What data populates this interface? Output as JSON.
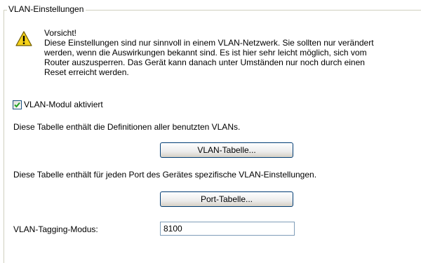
{
  "group": {
    "title": "VLAN-Einstellungen"
  },
  "warning": {
    "icon": "warning-triangle-icon",
    "title": "Vorsicht!",
    "lines": [
      "Diese Einstellungen sind nur sinnvoll in einem VLAN-Netzwerk. Sie sollten nur verändert",
      "werden, wenn die Auswirkungen bekannt sind. Es ist hier sehr leicht möglich, sich vom",
      "Router auszusperren. Das Gerät kann danach unter Umständen nur noch durch einen",
      "Reset erreicht werden."
    ]
  },
  "vlan_module": {
    "label": "VLAN-Modul aktiviert",
    "checked": true
  },
  "vlan_table": {
    "description": "Diese Tabelle enthält die Definitionen aller benutzten VLANs.",
    "button_label": "VLAN-Tabelle..."
  },
  "port_table": {
    "description": "Diese Tabelle enthält für jeden Port des Gerätes spezifische VLAN-Einstellungen.",
    "button_label": "Port-Tabelle..."
  },
  "tagging": {
    "label": "VLAN-Tagging-Modus:",
    "value": "8100"
  }
}
